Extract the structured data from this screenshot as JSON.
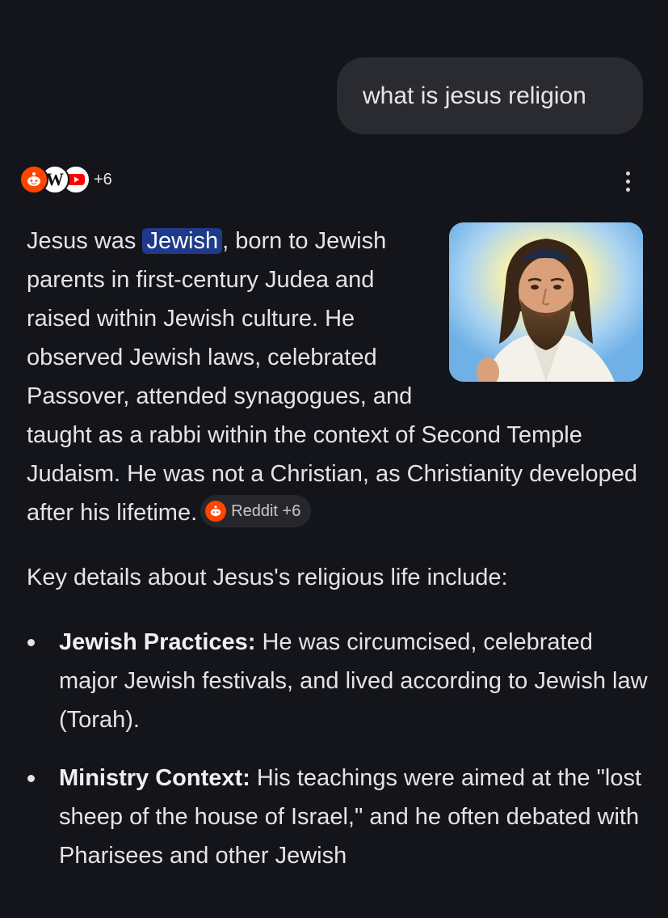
{
  "user_query": "what is jesus religion",
  "sources": {
    "icons": [
      "reddit-icon",
      "wikipedia-icon",
      "youtube-icon"
    ],
    "more_count": "+6"
  },
  "answer": {
    "p1_before": "Jesus was ",
    "p1_highlight": "Jewish",
    "p1_after": ", born to Jewish parents in first-century Judea and raised within Jewish culture. He observed Jewish laws, celebrated Passover, attended synagogues, and taught as a rabbi within the context of Second Temple Judaism. He was not a Christian, as Christianity developed after his lifetime.",
    "citation_chip": "Reddit +6",
    "intro": "Key details about Jesus's religious life include:",
    "bullets": [
      {
        "title": "Jewish Practices:",
        "text": " He was circumcised, celebrated major Jewish festivals, and lived according to Jewish law (Torah)."
      },
      {
        "title": "Ministry Context:",
        "text": " His teachings were aimed at the \"lost sheep of the house of Israel,\" and he often debated with Pharisees and other Jewish"
      }
    ]
  },
  "colors": {
    "background": "#14151a",
    "bubble": "#2a2b31",
    "highlight": "#1f3a8a",
    "reddit": "#ff4500",
    "youtube": "#ff0000"
  }
}
